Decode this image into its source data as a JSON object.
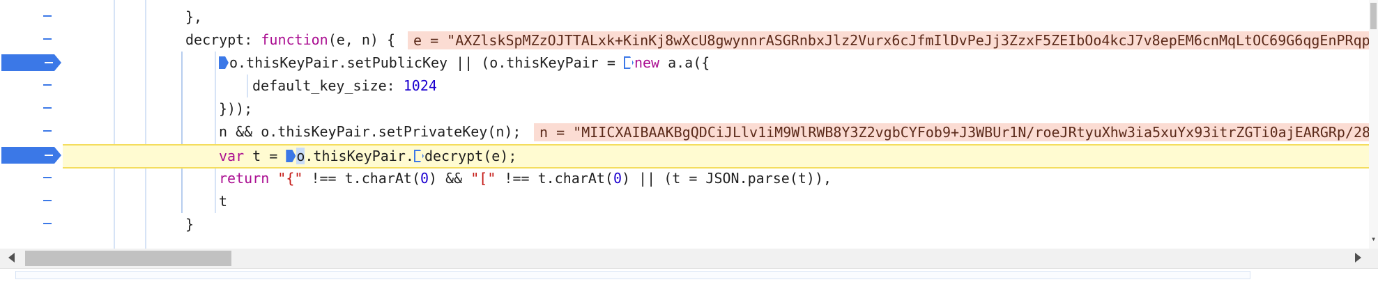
{
  "gutter": [
    {
      "marker": "-",
      "breakpoint": false
    },
    {
      "marker": "-",
      "breakpoint": false
    },
    {
      "marker": "-",
      "breakpoint": true
    },
    {
      "marker": "-",
      "breakpoint": false
    },
    {
      "marker": "-",
      "breakpoint": false
    },
    {
      "marker": "-",
      "breakpoint": false
    },
    {
      "marker": "-",
      "breakpoint": true
    },
    {
      "marker": "-",
      "breakpoint": false
    },
    {
      "marker": "-",
      "breakpoint": false
    },
    {
      "marker": "-",
      "breakpoint": false
    }
  ],
  "code": {
    "l1": "},",
    "l2": {
      "key": "decrypt",
      "colon": ": ",
      "kw": "function",
      "params": "(e, n) {",
      "inline": "e = \"AXZlskSpMZzOJTTALxk+KinKj8wXcU8gwynnrASGRnbxJlz2Vurx6cJfmIlDvPeJj3ZzxF5ZEIbOo4kcJ7v8epEM6cnMqLtOC69G6qgEnPRqp\""
    },
    "l3": {
      "a": "o.thisKeyPair.setPublicKey || (o.thisKeyPair = ",
      "kw": "new",
      "b": " a.a({"
    },
    "l4": {
      "key": "default_key_size: ",
      "num": "1024"
    },
    "l5": "}));",
    "l6": {
      "text": "n && o.thisKeyPair.setPrivateKey(n);",
      "inline": "n = \"MIICXAIBAAKBgQDCiJLlv1iM9WlRWB8Y3Z2vgbCYFob9+J3WBUr1N/roeJRtyuXhw3ia5xuYx93itrZGTi0ajEARGRp/28"
    },
    "l7": {
      "kw": "var",
      "a": " t = ",
      "sel": "o",
      "b": ".thisKeyPair.",
      "c": "decrypt(e);"
    },
    "l8": {
      "kw": "return",
      "s1": "\"{\"",
      "a": " !== t.charAt(",
      "n1": "0",
      "b": ") && ",
      "s2": "\"[\"",
      "c": " !== t.charAt(",
      "n2": "0",
      "d": ") || (t = JSON.parse(t)),"
    },
    "l9": "t",
    "l10": "}"
  },
  "colors": {
    "breakpoint": "#3b78e7",
    "highlight": "#fffbd1",
    "inline_value_bg": "#fbdcd3",
    "keyword": "#aa0d91",
    "string": "#c41a16",
    "number": "#1c00cf"
  }
}
